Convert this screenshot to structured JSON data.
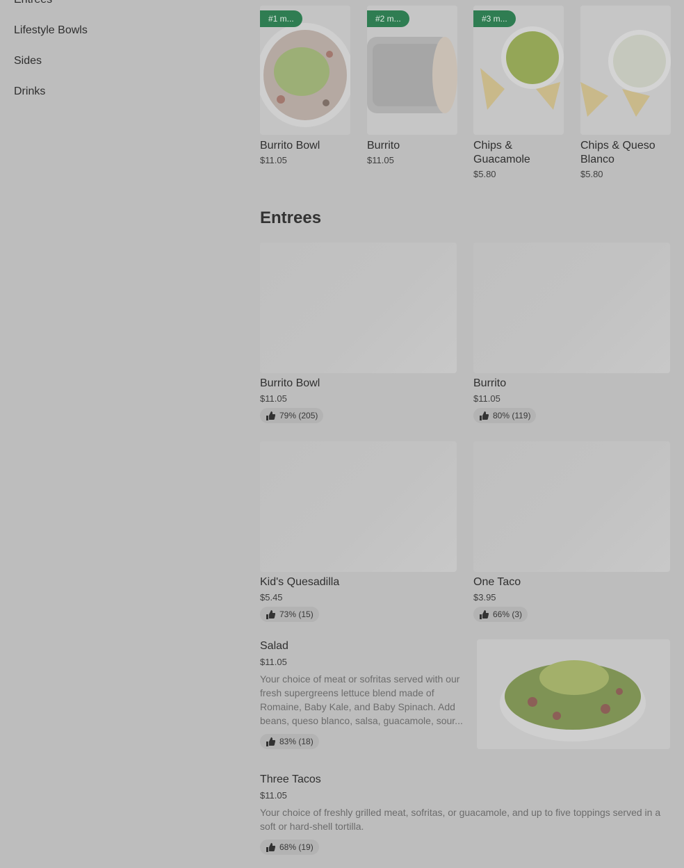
{
  "sidebar": {
    "items": [
      {
        "label": "Entrees"
      },
      {
        "label": "Lifestyle Bowls"
      },
      {
        "label": "Sides"
      },
      {
        "label": "Drinks"
      }
    ]
  },
  "popular": [
    {
      "rank": "#1 m...",
      "name": "Burrito Bowl",
      "price": "$11.05"
    },
    {
      "rank": "#2 m...",
      "name": "Burrito",
      "price": "$11.05"
    },
    {
      "rank": "#3 m...",
      "name": "Chips & Guacamole",
      "price": "$5.80"
    },
    {
      "rank": "",
      "name": "Chips & Queso Blanco",
      "price": "$5.80"
    }
  ],
  "entrees": {
    "title": "Entrees",
    "cards": [
      {
        "name": "Burrito Bowl",
        "price": "$11.05",
        "rating": "79% (205)"
      },
      {
        "name": "Burrito",
        "price": "$11.05",
        "rating": "80% (119)"
      },
      {
        "name": "Kid's Quesadilla",
        "price": "$5.45",
        "rating": "73% (15)"
      },
      {
        "name": "One Taco",
        "price": "$3.95",
        "rating": "66% (3)"
      }
    ],
    "list": [
      {
        "name": "Salad",
        "price": "$11.05",
        "description": "Your choice of meat or sofritas served with our fresh supergreens lettuce blend made of Romaine, Baby Kale, and Baby Spinach. Add beans, queso blanco, salsa, guacamole, sour...",
        "rating": "83% (18)"
      },
      {
        "name": "Three Tacos",
        "price": "$11.05",
        "description": "Your choice of freshly grilled meat, sofritas, or guacamole, and up to five toppings served in a soft or hard-shell tortilla.",
        "rating": "68% (19)"
      }
    ]
  },
  "colors": {
    "badge": "#2f7d52",
    "overlay": "#bdbdbd"
  }
}
